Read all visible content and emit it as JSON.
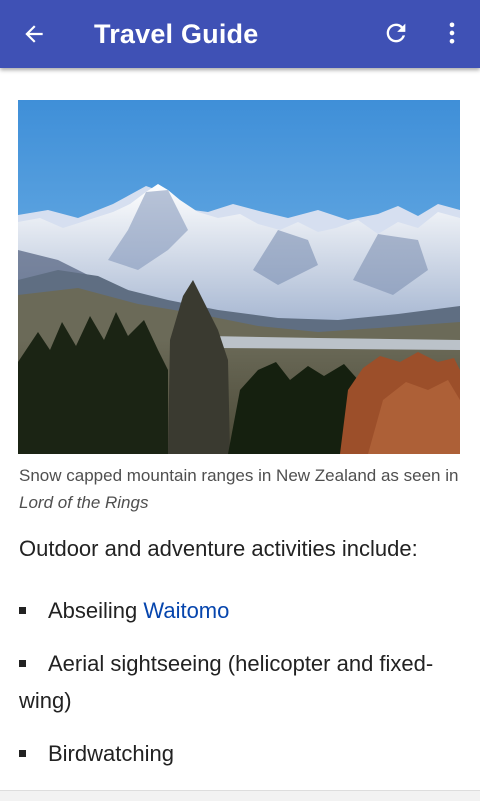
{
  "app_bar": {
    "title": "Travel Guide",
    "back_icon": "arrow-back-icon",
    "refresh_icon": "refresh-icon",
    "more_icon": "more-vert-icon",
    "background": "#3f51b5"
  },
  "article": {
    "image_alt": "Snow capped mountain ranges in New Zealand",
    "caption_text": "Snow capped mountain ranges in New Zealand as seen in ",
    "caption_italic": "Lord of the Rings",
    "intro": "Outdoor and adventure activities include:",
    "activities": [
      {
        "text": "Abseiling ",
        "link": "Waitomo"
      },
      {
        "text": "Aerial sightseeing (helicopter and fixed-wing)"
      },
      {
        "text": "Birdwatching"
      }
    ],
    "link_color": "#0645ad"
  }
}
